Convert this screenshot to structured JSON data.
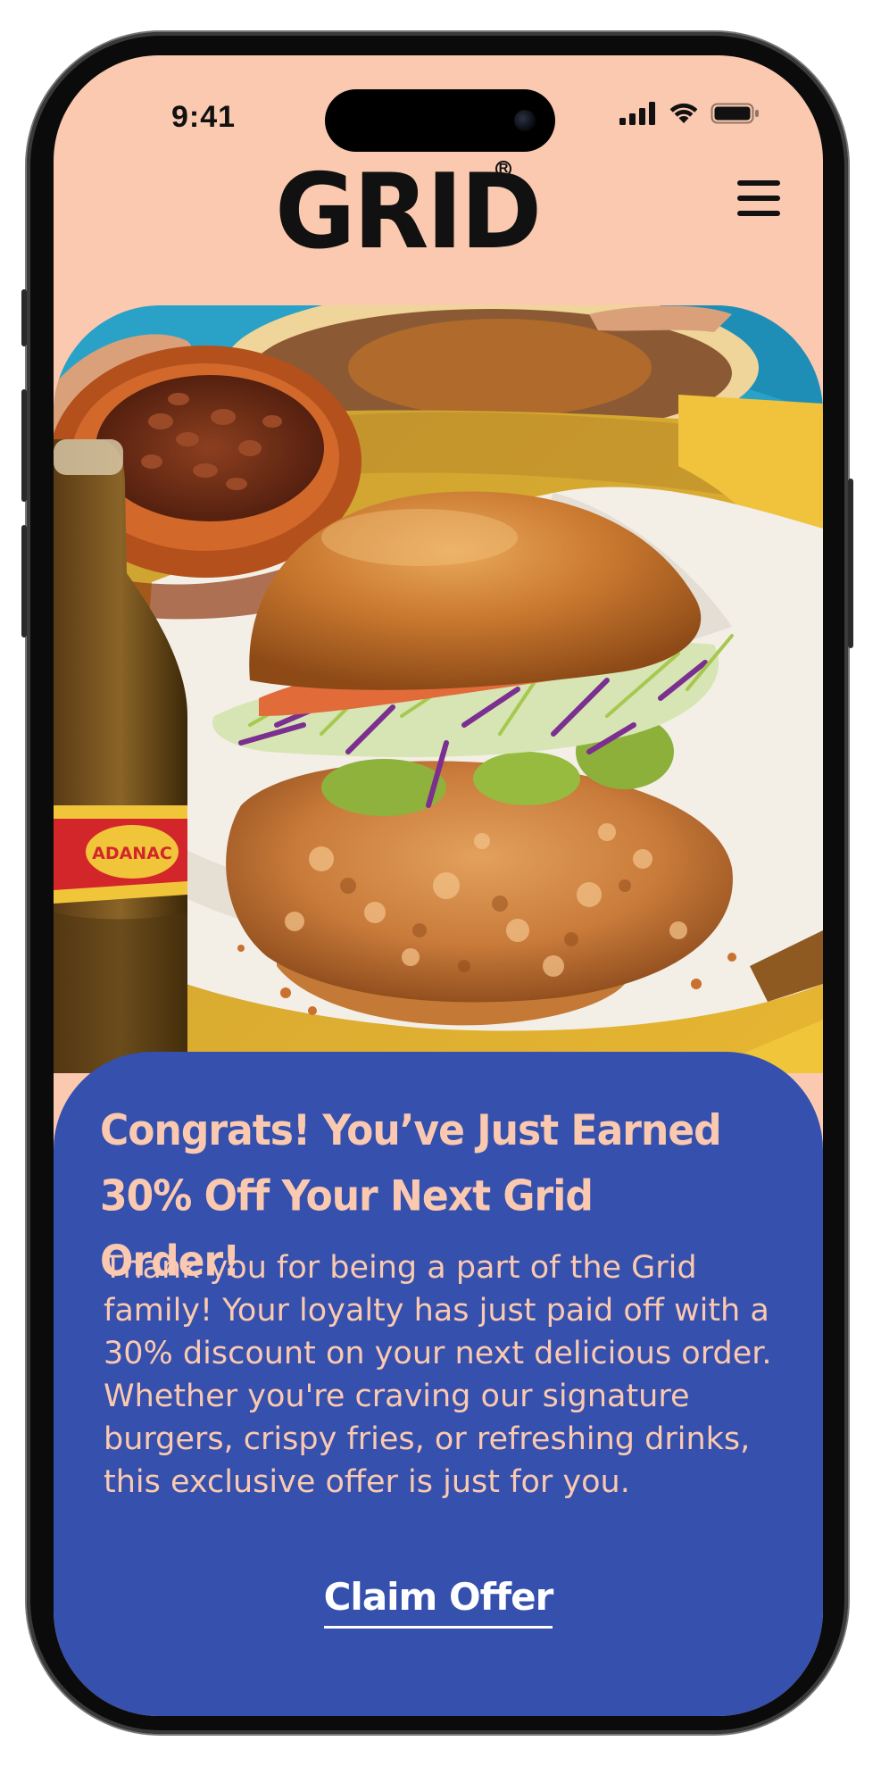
{
  "status_bar": {
    "time": "9:41",
    "icons": [
      "cellular-signal-icon",
      "wifi-icon",
      "battery-icon"
    ]
  },
  "header": {
    "logo_text": "GRID",
    "logo_mark": "R",
    "menu_icon": "hamburger-menu-icon"
  },
  "hero": {
    "description_icon": "fried-chicken-sandwich-photo"
  },
  "offer": {
    "title": "Congrats! You’ve Just Earned 30% Off Your Next Grid Order!",
    "body": "Thank you for being a part of the Grid family! Your loyalty has just paid off with a 30% discount on your next delicious order. Whether you're craving our signature burgers, crispy fries, or refreshing drinks, this exclusive offer is just for you.",
    "cta_label": "Claim Offer"
  },
  "bottle_label": "ADANAC",
  "colors": {
    "header_bg": "#fbc9b0",
    "card_bg": "#3550ad",
    "card_text": "#fbc9b0",
    "cta_text": "#ffffff",
    "logo": "#111111"
  }
}
